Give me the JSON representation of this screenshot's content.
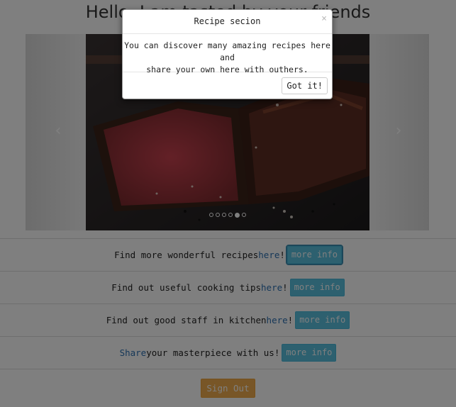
{
  "page": {
    "title": "Hello, I am tasted by your friends"
  },
  "carousel": {
    "prev_icon": "chevron-left-icon",
    "next_icon": "chevron-right-icon",
    "indicator_count": 6,
    "active_indicator": 4,
    "image_description": "steak"
  },
  "rows": [
    {
      "before": "Find more wonderful recipes ",
      "link": "here",
      "after": " !",
      "button": "more info"
    },
    {
      "before": "Find out useful cooking tips ",
      "link": "here",
      "after": " !",
      "button": "more info"
    },
    {
      "before": "Find out good staff in kitchen ",
      "link": "here",
      "after": " !",
      "button": "more info"
    },
    {
      "before": "",
      "link": "Share",
      "after": " your masterpiece with us!",
      "button": "more info"
    }
  ],
  "sign_out": "Sign Out",
  "modal": {
    "title": "Recipe secion",
    "close": "×",
    "body_line1": "You can discover many amazing recipes here and",
    "body_line2": "share your own here with outhers.",
    "ok_button": "Got it!"
  },
  "colors": {
    "info": "#5bc0de",
    "warning": "#f0ad4e",
    "link": "#2a6fb1"
  }
}
